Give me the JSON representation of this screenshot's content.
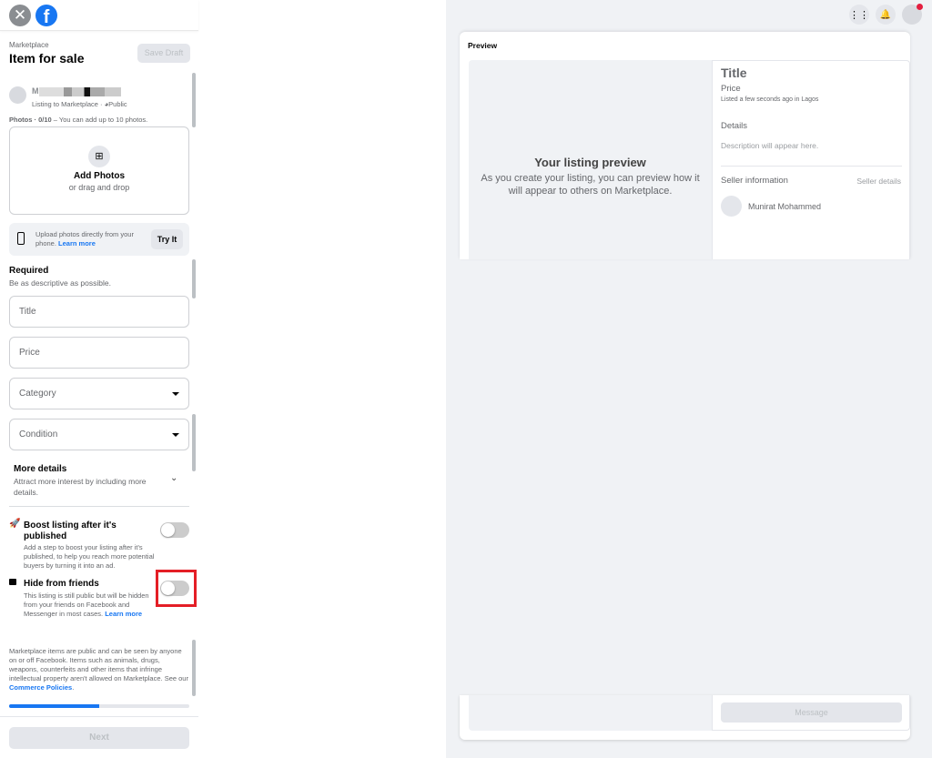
{
  "header": {
    "close_icon": "close-icon",
    "logo": "facebook-logo"
  },
  "form": {
    "breadcrumb": "Marketplace",
    "title": "Item for sale",
    "save_draft": "Save Draft",
    "user": {
      "name_visible": "M",
      "listing_to": "Listing to Marketplace · ",
      "audience": "Public"
    },
    "photos": {
      "label": "Photos · 0/10",
      "hint": " – You can add up to 10 photos.",
      "add": "Add Photos",
      "drag": "or drag and drop"
    },
    "phone_upload": {
      "text": "Upload photos directly from your phone. ",
      "link": "Learn more",
      "button": "Try It"
    },
    "required": {
      "heading": "Required",
      "sub": "Be as descriptive as possible."
    },
    "fields": {
      "title": "Title",
      "price": "Price",
      "category": "Category",
      "condition": "Condition"
    },
    "more_details": {
      "heading": "More details",
      "sub": "Attract more interest by including more details."
    },
    "boost": {
      "heading": "Boost listing after it's published",
      "desc": "Add a step to boost your listing after it's published, to help you reach more potential buyers by turning it into an ad.",
      "enabled": false
    },
    "hide": {
      "heading": "Hide from friends",
      "desc": "This listing is still public but will be hidden from your friends on Facebook and Messenger in most cases. ",
      "link": "Learn more",
      "enabled": false,
      "highlight_color": "#e41e26"
    },
    "policy": {
      "text": "Marketplace items are public and can be seen by anyone on or off Facebook. Items such as animals, drugs, weapons, counterfeits and other items that infringe intellectual property aren't allowed on Marketplace. See our ",
      "link": "Commerce Policies",
      "end": "."
    },
    "progress_percent": 50,
    "next": "Next"
  },
  "preview": {
    "label": "Preview",
    "placeholder_heading": "Your listing preview",
    "placeholder_text": "As you create your listing, you can preview how it will appear to others on Marketplace.",
    "title": "Title",
    "price": "Price",
    "listed": "Listed a few seconds ago in Lagos",
    "details": "Details",
    "description": "Description will appear here.",
    "seller_info": "Seller information",
    "seller_details": "Seller details",
    "seller_name": "Munirat Mohammed",
    "message": "Message"
  },
  "colors": {
    "brand": "#1877f2",
    "notification": "#e41e3f"
  }
}
